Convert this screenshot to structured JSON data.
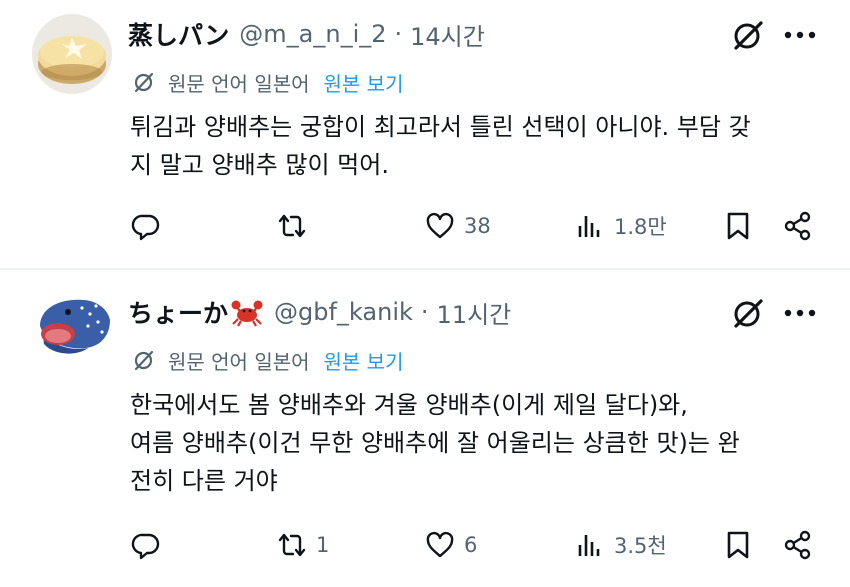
{
  "posts": [
    {
      "display_name": "蒸しパン",
      "handle": "@m_a_n_i_2",
      "separator": "·",
      "time": "14시간",
      "translation_note": "원문 언어 일본어",
      "show_original": "원본 보기",
      "text_lines": [
        "튀김과 양배추는 궁합이 최고라서 틀린 선택이 아니야. 부담 갖",
        "지 말고 양배추 많이 먹어."
      ],
      "reply_count": "",
      "retweet_count": "",
      "like_count": "38",
      "view_count": "1.8만",
      "avatar_icon": "steamed-bun-avatar"
    },
    {
      "display_name": "ちょーか",
      "emoji": "crab-emoji",
      "handle": "@gbf_kanik",
      "separator": "·",
      "time": "11시간",
      "translation_note": "원문 언어 일본어",
      "show_original": "원본 보기",
      "text_lines": [
        "한국에서도 봄 양배추와 겨울 양배추(이게 제일 달다)와,",
        "여름 양배추(이건 무한 양배추에 잘 어울리는 상큼한 맛)는 완",
        "전히 다른 거야"
      ],
      "reply_count": "",
      "retweet_count": "1",
      "like_count": "6",
      "view_count": "3.5천",
      "avatar_icon": "whale-shark-avatar"
    }
  ],
  "colors": {
    "text_primary": "#0f1419",
    "text_secondary": "#536471",
    "link_blue": "#1d9bf0",
    "divider": "#eff3f4"
  },
  "icons": [
    "grok-icon",
    "more-icon",
    "translate-icon",
    "reply-icon",
    "retweet-icon",
    "like-icon",
    "views-icon",
    "bookmark-icon",
    "share-icon"
  ]
}
